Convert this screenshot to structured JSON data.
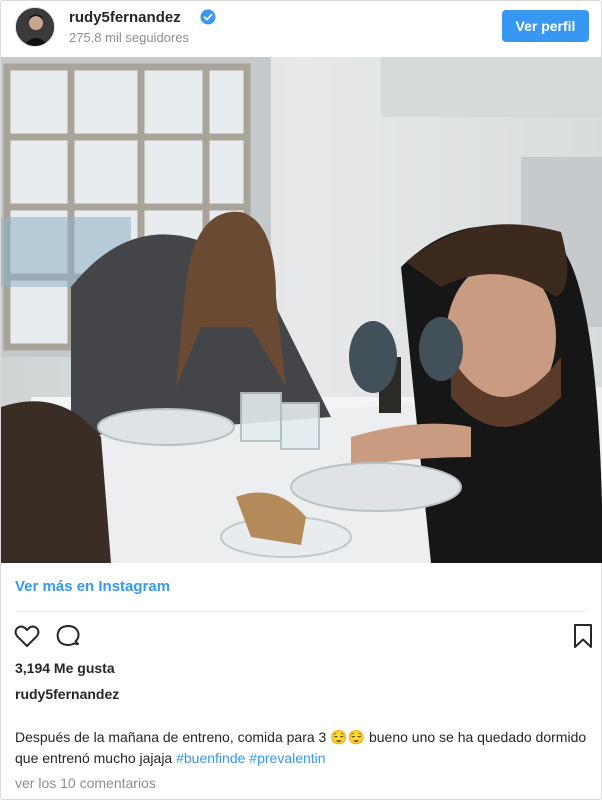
{
  "header": {
    "username": "rudy5fernandez",
    "followers": "275.8 mil seguidores",
    "profile_button": "Ver perfil"
  },
  "post": {
    "see_more": "Ver más en Instagram",
    "likes": "3,194 Me gusta",
    "author": "rudy5fernandez",
    "caption_text": "Después de la mañana de entreno, comida para 3 😌😌 bueno uno se ha quedado dormido que entrenó mucho jajaja ",
    "hashtags": [
      "#buenfinde",
      "#prevalentin"
    ],
    "view_comments": "ver los 10 comentarios"
  },
  "icons": {
    "like": "heart-icon",
    "comment": "comment-icon",
    "save": "bookmark-icon",
    "verified": "verified-badge-icon"
  },
  "colors": {
    "accent": "#3897f0",
    "text": "#262626",
    "muted": "#8e8e8e"
  }
}
